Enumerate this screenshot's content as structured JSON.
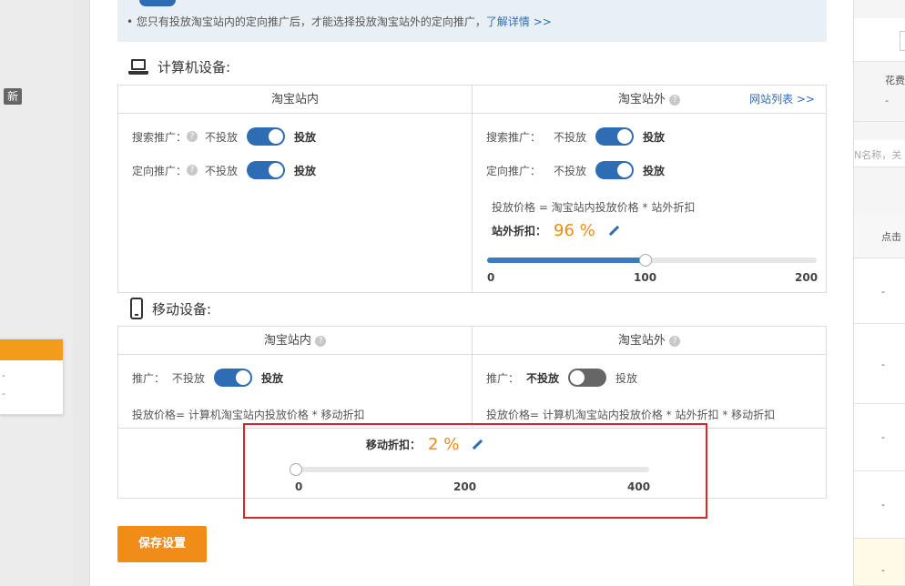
{
  "left": {
    "new_badge": "新",
    "card_items": [
      "-",
      "-"
    ]
  },
  "notice": {
    "line1": "您只有投放淘宝站内的定向推广后，才能选择投放淘宝站外的定向推广，",
    "link": "了解详情 >>"
  },
  "computer": {
    "title": "计算机设备:",
    "inside": {
      "header": "淘宝站内",
      "rows": [
        {
          "label": "搜索推广：",
          "off": "不投放",
          "on": "投放",
          "enabled": true
        },
        {
          "label": "定向推广：",
          "off": "不投放",
          "on": "投放",
          "enabled": true
        }
      ]
    },
    "outside": {
      "header": "淘宝站外",
      "site_list_link": "网站列表 >>",
      "rows": [
        {
          "label": "搜索推广：",
          "off": "不投放",
          "on": "投放",
          "enabled": true
        },
        {
          "label": "定向推广：",
          "off": "不投放",
          "on": "投放",
          "enabled": true
        }
      ],
      "formula": "投放价格 = 淘宝站内投放价格 * 站外折扣",
      "discount_label": "站外折扣：",
      "discount_value": "96 %",
      "slider": {
        "min": "0",
        "mid": "100",
        "max": "200",
        "value": 96,
        "range_max": 200
      }
    }
  },
  "mobile": {
    "title": "移动设备:",
    "inside": {
      "header": "淘宝站内",
      "row": {
        "label": "推广：",
        "off": "不投放",
        "on": "投放",
        "enabled": true
      },
      "formula": "投放价格= 计算机淘宝站内投放价格 * 移动折扣"
    },
    "outside": {
      "header": "淘宝站外",
      "row": {
        "label": "推广：",
        "off": "不投放",
        "on": "投放",
        "enabled": false
      },
      "formula": "投放价格= 计算机淘宝站内投放价格 * 站外折扣 * 移动折扣"
    },
    "discount_label": "移动折扣：",
    "discount_value": "2 %",
    "slider": {
      "min": "0",
      "mid": "200",
      "max": "400",
      "value": 2,
      "range_max": 400
    }
  },
  "save_button": "保存设置",
  "right_bg": {
    "header": "花费",
    "dash": "-",
    "search_placeholder": "N名称，关",
    "col": "点击",
    "row_dashes": [
      "-",
      "-",
      "-",
      "-",
      "-"
    ]
  },
  "colors": {
    "accent": "#2e6db3",
    "orange": "#f08c18",
    "highlight": "#d9232d"
  }
}
